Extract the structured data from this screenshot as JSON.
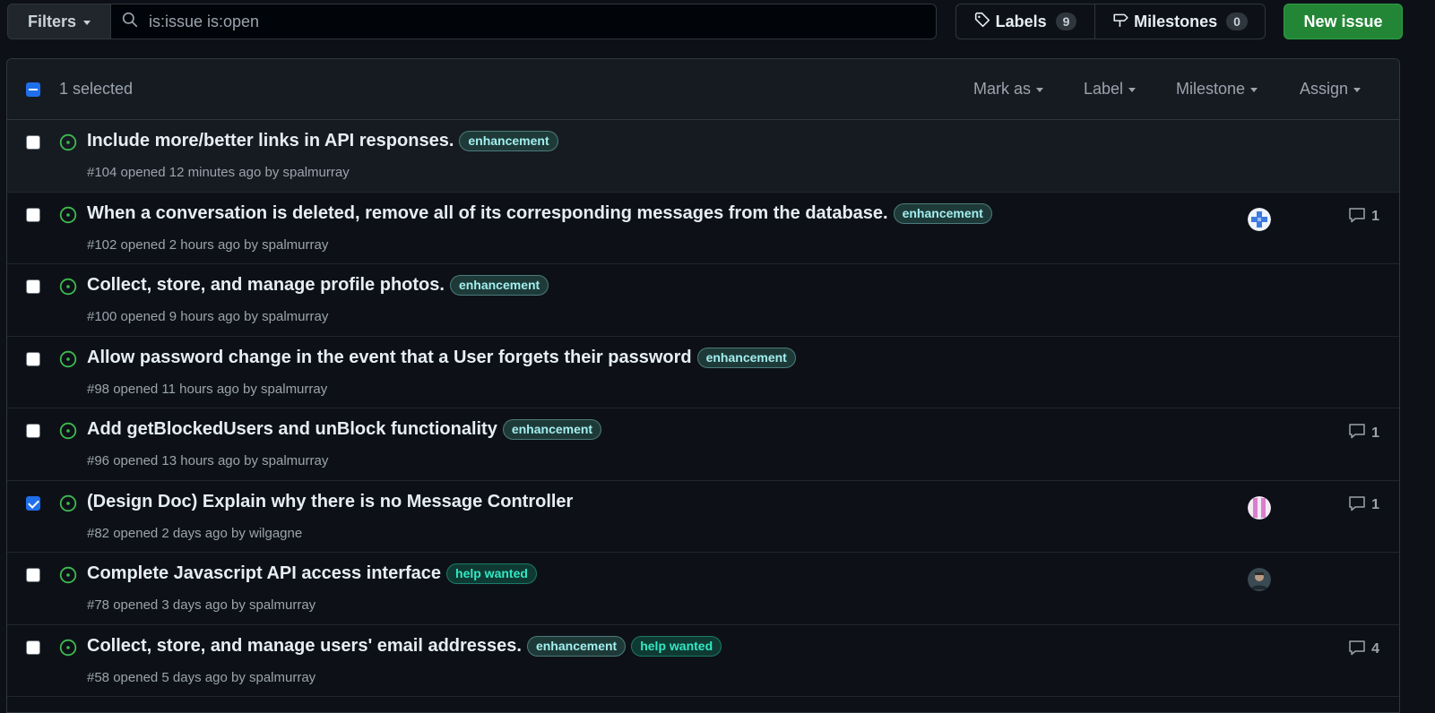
{
  "toolbar": {
    "filters_label": "Filters",
    "search_value": "is:issue is:open",
    "labels_label": "Labels",
    "labels_count": "9",
    "milestones_label": "Milestones",
    "milestones_count": "0",
    "new_issue_label": "New issue"
  },
  "box_header": {
    "selected_text": "1 selected",
    "menus": [
      "Mark as",
      "Label",
      "Milestone",
      "Assign"
    ]
  },
  "colors": {
    "open_icon": "#3fb950",
    "accent": "#1f6feb",
    "new_issue_bg": "#238636"
  },
  "issues": [
    {
      "title": "Include more/better links in API responses.",
      "labels": [
        "enhancement"
      ],
      "meta": "#104 opened 12 minutes ago by spalmurray",
      "checked": false,
      "avatar": "",
      "comments": ""
    },
    {
      "title": "When a conversation is deleted, remove all of its corresponding messages from the database.",
      "labels": [
        "enhancement"
      ],
      "meta": "#102 opened 2 hours ago by spalmurray",
      "checked": false,
      "avatar": "blue-cross-avatar",
      "comments": "1"
    },
    {
      "title": "Collect, store, and manage profile photos.",
      "labels": [
        "enhancement"
      ],
      "meta": "#100 opened 9 hours ago by spalmurray",
      "checked": false,
      "avatar": "",
      "comments": ""
    },
    {
      "title": "Allow password change in the event that a User forgets their password",
      "labels": [
        "enhancement"
      ],
      "meta": "#98 opened 11 hours ago by spalmurray",
      "checked": false,
      "avatar": "",
      "comments": ""
    },
    {
      "title": "Add getBlockedUsers and unBlock functionality",
      "labels": [
        "enhancement"
      ],
      "meta": "#96 opened 13 hours ago by spalmurray",
      "checked": false,
      "avatar": "",
      "comments": "1"
    },
    {
      "title": "(Design Doc) Explain why there is no Message Controller",
      "labels": [],
      "meta": "#82 opened 2 days ago by wilgagne",
      "checked": true,
      "avatar": "pink-stripe-avatar",
      "comments": "1"
    },
    {
      "title": "Complete Javascript API access interface",
      "labels": [
        "help wanted"
      ],
      "meta": "#78 opened 3 days ago by spalmurray",
      "checked": false,
      "avatar": "photo-avatar",
      "comments": ""
    },
    {
      "title": "Collect, store, and manage users' email addresses.",
      "labels": [
        "enhancement",
        "help wanted"
      ],
      "meta": "#58 opened 5 days ago by spalmurray",
      "checked": false,
      "avatar": "",
      "comments": "4"
    }
  ]
}
